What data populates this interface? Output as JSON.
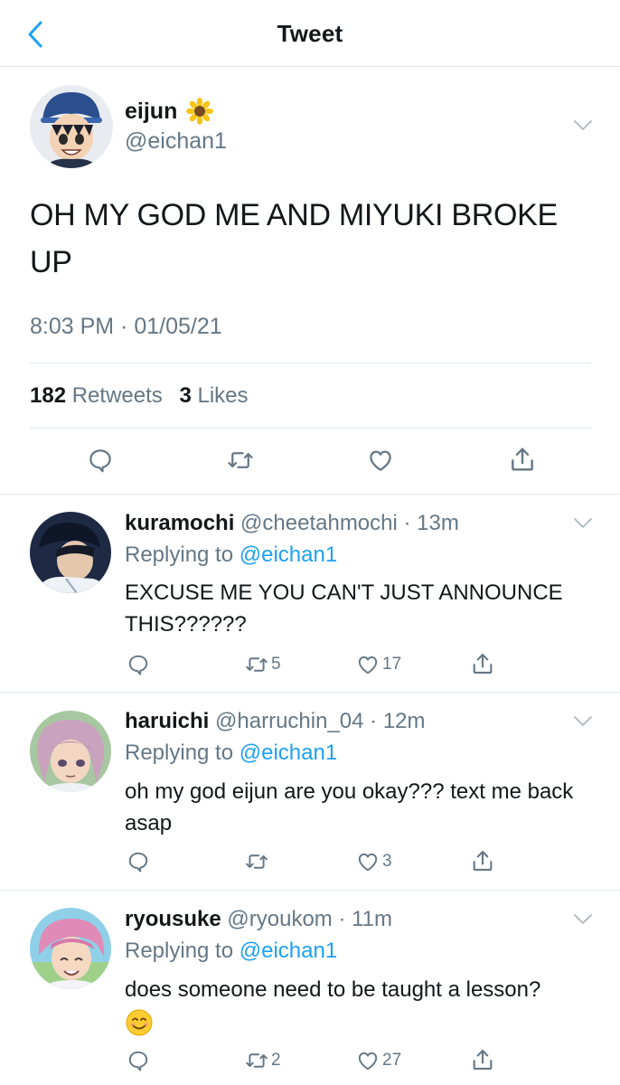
{
  "header": {
    "title": "Tweet"
  },
  "main_tweet": {
    "name": "eijun",
    "handle": "@eichan1",
    "text": "OH MY GOD ME AND MIYUKI BROKE UP",
    "timestamp": "8:03 PM · 01/05/21",
    "retweets_count": "182",
    "retweets_label": "Retweets",
    "likes_count": "3",
    "likes_label": "Likes"
  },
  "replies": [
    {
      "name": "kuramochi",
      "handle": "@cheetahmochi",
      "time": "13m",
      "replying_label": "Replying to",
      "replying_to": "@eichan1",
      "text": "EXCUSE ME YOU CAN'T JUST ANNOUNCE THIS??????",
      "retweets": "5",
      "likes": "17"
    },
    {
      "name": "haruichi",
      "handle": "@harruchin_04",
      "time": "12m",
      "replying_label": "Replying to",
      "replying_to": "@eichan1",
      "text": "oh my god eijun are you okay??? text me back asap",
      "retweets": "",
      "likes": "3"
    },
    {
      "name": "ryousuke",
      "handle": "@ryoukom",
      "time": "11m",
      "replying_label": "Replying to",
      "replying_to": "@eichan1",
      "text": "does someone need to be taught a lesson?",
      "retweets": "2",
      "likes": "27"
    }
  ],
  "colors": {
    "accent": "#1da1f2",
    "muted": "#657786",
    "divider": "#e1e6ea",
    "text": "#14171a"
  },
  "icons": [
    "back-chevron-icon",
    "sunflower-emoji-icon",
    "chevron-down-icon",
    "reply-icon",
    "retweet-icon",
    "like-icon",
    "share-icon",
    "smiling-face-emoji-icon"
  ]
}
